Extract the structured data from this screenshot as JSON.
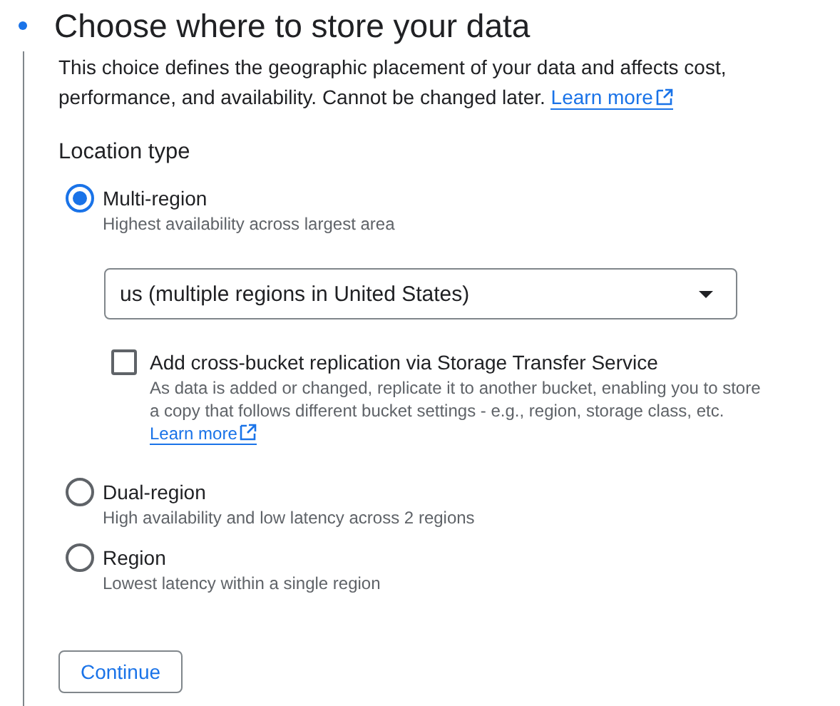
{
  "step": {
    "title": "Choose where to store your data",
    "description": "This choice defines the geographic placement of your data and affects cost, performance, and availability. Cannot be changed later.",
    "learn_more": "Learn more"
  },
  "location_type": {
    "heading": "Location type",
    "options": [
      {
        "label": "Multi-region",
        "hint": "Highest availability across largest area",
        "selected": true,
        "location_select": {
          "value": "us (multiple regions in United States)"
        },
        "replication": {
          "label": "Add cross-bucket replication via Storage Transfer Service",
          "description": "As data is added or changed, replicate it to another bucket, enabling you to store a copy that follows different bucket settings - e.g., region, storage class, etc.",
          "learn_more": "Learn more",
          "checked": false
        }
      },
      {
        "label": "Dual-region",
        "hint": "High availability and low latency across 2 regions",
        "selected": false
      },
      {
        "label": "Region",
        "hint": "Lowest latency within a single region",
        "selected": false
      }
    ]
  },
  "continue_button": "Continue"
}
